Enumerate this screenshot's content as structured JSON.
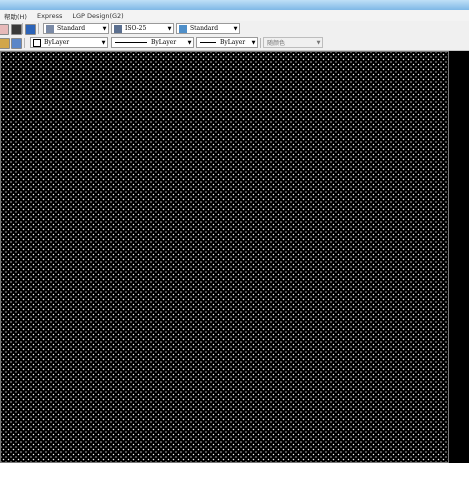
{
  "menubar": {
    "items": [
      "帮助(H)",
      "Express",
      "LGP Design(G2)"
    ]
  },
  "toolbar1": {
    "text_style": {
      "value": "Standard",
      "icon": "text-style-icon"
    },
    "dim_style": {
      "value": "ISO-25",
      "icon": "dimension-style-icon"
    },
    "table_style": {
      "value": "Standard",
      "icon": "table-style-icon"
    }
  },
  "toolbar2": {
    "color": {
      "value": "ByLayer"
    },
    "linetype": {
      "value": "ByLayer"
    },
    "lineweight": {
      "value": "ByLayer"
    },
    "plot_style": {
      "value": "随颜色"
    }
  },
  "colors": {
    "canvas": "#000000",
    "toolbar": "#f0f0f0",
    "titlebar": "#7fb8e6"
  }
}
